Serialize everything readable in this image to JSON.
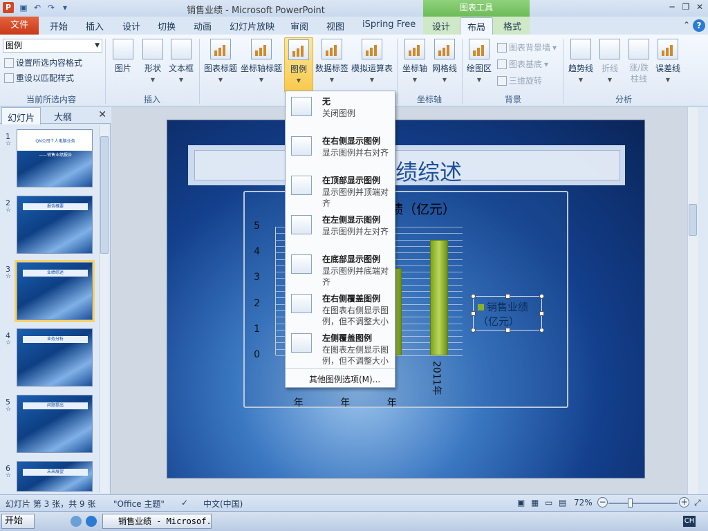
{
  "window": {
    "title": "销售业绩 - Microsoft PowerPoint",
    "context_header": "图表工具"
  },
  "tabs": {
    "file": "文件",
    "items": [
      "开始",
      "插入",
      "设计",
      "切换",
      "动画",
      "幻灯片放映",
      "审阅",
      "视图",
      "iSpring Free",
      "设计",
      "布局",
      "格式"
    ],
    "active": "布局"
  },
  "ribbon": {
    "selection_value": "图例",
    "format_selection": "设置所选内容格式",
    "reset_style": "重设以匹配样式",
    "group_current": "当前所选内容",
    "insert": {
      "picture": "图片",
      "shapes": "形状",
      "textbox": "文本框",
      "group": "插入"
    },
    "labels": {
      "chart_title": "图表标题",
      "axis_titles": "坐标轴标题",
      "legend": "图例",
      "data_labels": "数据标签",
      "data_table": "模拟运算表"
    },
    "axes": {
      "axes": "坐标轴",
      "gridlines": "网格线",
      "group": "坐标轴"
    },
    "background": {
      "plot_area": "绘图区",
      "chart_wall": "图表背景墙",
      "chart_floor": "图表基底",
      "rotation": "三维旋转",
      "group": "背景"
    },
    "analysis": {
      "trendline": "趋势线",
      "lines": "折线",
      "updown": "涨/跌",
      "updown2": "柱线",
      "errorbars": "误差线",
      "group": "分析"
    }
  },
  "leftpane": {
    "tab_slides": "幻灯片",
    "tab_outline": "大纲",
    "thumbs": [
      {
        "num": "1",
        "title": "QN公司个人电脑业务",
        "sub": "——销售业绩报告"
      },
      {
        "num": "2",
        "title": "报告概要"
      },
      {
        "num": "3",
        "title": "业绩综述"
      },
      {
        "num": "4",
        "title": "业务分析"
      },
      {
        "num": "5",
        "title": "问题提出"
      },
      {
        "num": "6",
        "title": "未来展望"
      }
    ]
  },
  "slide": {
    "title_visible": "绩综述",
    "chart": {
      "title_visible": "绩（亿元）",
      "legend": "销售业绩（亿元）",
      "x_visible": [
        "年",
        "年",
        "年",
        "2011年"
      ]
    }
  },
  "chart_data": {
    "type": "bar",
    "title": "绩（亿元）",
    "categories": [
      "年",
      "年",
      "年",
      "2011年"
    ],
    "series": [
      {
        "name": "销售业绩（亿元）",
        "values": [
          4.2,
          3.5,
          3.4,
          4.5
        ]
      }
    ],
    "yticks": [
      0,
      1,
      2,
      3,
      4,
      5
    ],
    "ylim": [
      0,
      5
    ],
    "grid": true,
    "legend_position": "right"
  },
  "menu": {
    "items": [
      {
        "title": "无",
        "desc": "关闭图例"
      },
      {
        "title": "在右侧显示图例",
        "desc": "显示图例并右对齐"
      },
      {
        "title": "在顶部显示图例",
        "desc": "显示图例并顶端对齐"
      },
      {
        "title": "在左侧显示图例",
        "desc": "显示图例并左对齐"
      },
      {
        "title": "在底部显示图例",
        "desc": "显示图例并底端对齐"
      },
      {
        "title": "在右侧覆盖图例",
        "desc": "在图表右侧显示图例，但不调整大小"
      },
      {
        "title": "左侧覆盖图例",
        "desc": "在图表左侧显示图例，但不调整大小"
      }
    ],
    "more": "其他图例选项(M)..."
  },
  "status": {
    "slide_info": "幻灯片 第 3 张，共 9 张",
    "theme": "\"Office 主题\"",
    "language": "中文(中国)",
    "zoom": "72%"
  },
  "taskbar": {
    "start": "开始",
    "task": "销售业绩 - Microsof...",
    "ime": "CH"
  },
  "colors": {
    "file_tab": "#d24726",
    "context_tab": "#6dbb58",
    "bar": "#9cc03a",
    "slide_bg": "#133f8c"
  }
}
